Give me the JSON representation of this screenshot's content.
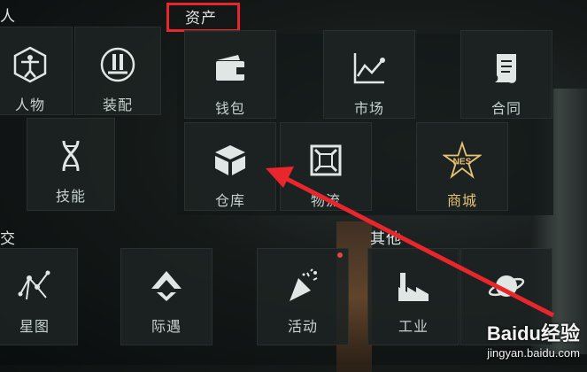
{
  "sections": {
    "personal": "人",
    "assets": "资产",
    "social": "交",
    "other": "其他"
  },
  "tiles": {
    "person": "人物",
    "equip": "装配",
    "skill": "技能",
    "wallet": "钱包",
    "market": "市场",
    "contract": "合同",
    "warehouse": "仓库",
    "logistics": "物流",
    "store": "商城",
    "starmap": "星图",
    "encounter": "际遇",
    "event": "活动",
    "industry": "工业"
  },
  "store_logo_text": "NES",
  "watermark": {
    "brand": "Baidu经验",
    "url": "jingyan.baidu.com"
  },
  "colors": {
    "highlight": "#e8262b",
    "gold": "#e7c275",
    "background": "#151a19"
  }
}
